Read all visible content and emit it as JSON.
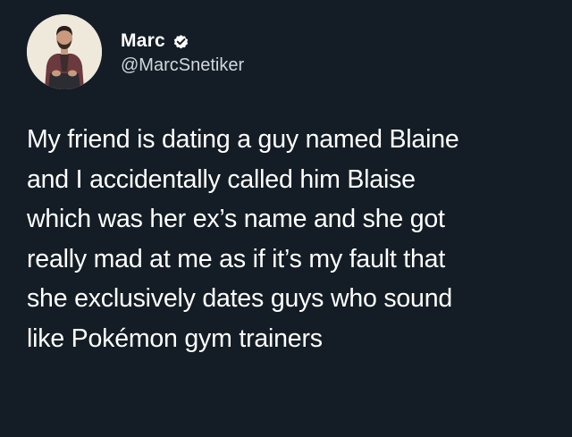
{
  "user": {
    "display_name": "Marc",
    "handle": "@MarcSnetiker",
    "verified_icon": "verified-badge-icon",
    "avatar": "profile-photo"
  },
  "tweet": {
    "lines": [
      "My friend is dating a guy named Blaine",
      "and I accidentally called him Blaise",
      "which was her ex’s name and she got",
      "really mad at me as if it’s my fault that",
      "she exclusively dates guys who sound",
      "like Pokémon gym trainers"
    ]
  },
  "colors": {
    "background": "#141d26",
    "text": "#ffffff",
    "handle": "#d0d6dc"
  }
}
